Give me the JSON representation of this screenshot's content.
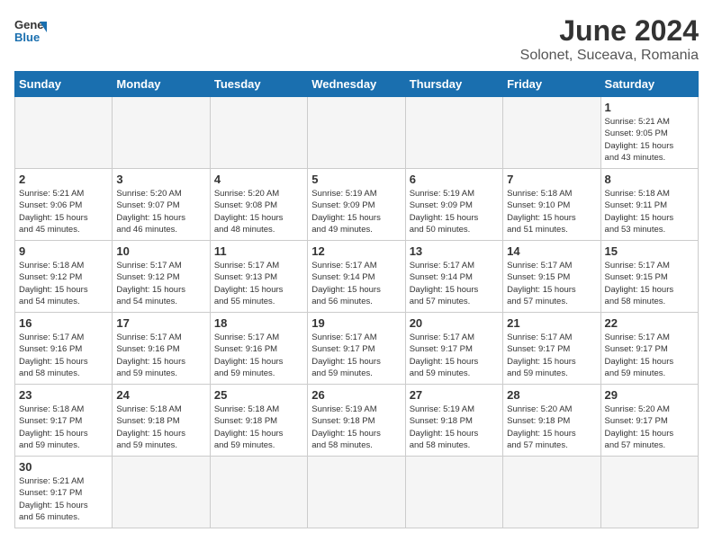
{
  "header": {
    "logo_general": "General",
    "logo_blue": "Blue",
    "title": "June 2024",
    "subtitle": "Solonet, Suceava, Romania"
  },
  "weekdays": [
    "Sunday",
    "Monday",
    "Tuesday",
    "Wednesday",
    "Thursday",
    "Friday",
    "Saturday"
  ],
  "weeks": [
    [
      {
        "day": "",
        "info": ""
      },
      {
        "day": "",
        "info": ""
      },
      {
        "day": "",
        "info": ""
      },
      {
        "day": "",
        "info": ""
      },
      {
        "day": "",
        "info": ""
      },
      {
        "day": "",
        "info": ""
      },
      {
        "day": "1",
        "info": "Sunrise: 5:21 AM\nSunset: 9:05 PM\nDaylight: 15 hours\nand 43 minutes."
      }
    ],
    [
      {
        "day": "2",
        "info": "Sunrise: 5:21 AM\nSunset: 9:06 PM\nDaylight: 15 hours\nand 45 minutes."
      },
      {
        "day": "3",
        "info": "Sunrise: 5:20 AM\nSunset: 9:07 PM\nDaylight: 15 hours\nand 46 minutes."
      },
      {
        "day": "4",
        "info": "Sunrise: 5:20 AM\nSunset: 9:08 PM\nDaylight: 15 hours\nand 48 minutes."
      },
      {
        "day": "5",
        "info": "Sunrise: 5:19 AM\nSunset: 9:09 PM\nDaylight: 15 hours\nand 49 minutes."
      },
      {
        "day": "6",
        "info": "Sunrise: 5:19 AM\nSunset: 9:09 PM\nDaylight: 15 hours\nand 50 minutes."
      },
      {
        "day": "7",
        "info": "Sunrise: 5:18 AM\nSunset: 9:10 PM\nDaylight: 15 hours\nand 51 minutes."
      },
      {
        "day": "8",
        "info": "Sunrise: 5:18 AM\nSunset: 9:11 PM\nDaylight: 15 hours\nand 53 minutes."
      }
    ],
    [
      {
        "day": "9",
        "info": "Sunrise: 5:18 AM\nSunset: 9:12 PM\nDaylight: 15 hours\nand 54 minutes."
      },
      {
        "day": "10",
        "info": "Sunrise: 5:17 AM\nSunset: 9:12 PM\nDaylight: 15 hours\nand 54 minutes."
      },
      {
        "day": "11",
        "info": "Sunrise: 5:17 AM\nSunset: 9:13 PM\nDaylight: 15 hours\nand 55 minutes."
      },
      {
        "day": "12",
        "info": "Sunrise: 5:17 AM\nSunset: 9:14 PM\nDaylight: 15 hours\nand 56 minutes."
      },
      {
        "day": "13",
        "info": "Sunrise: 5:17 AM\nSunset: 9:14 PM\nDaylight: 15 hours\nand 57 minutes."
      },
      {
        "day": "14",
        "info": "Sunrise: 5:17 AM\nSunset: 9:15 PM\nDaylight: 15 hours\nand 57 minutes."
      },
      {
        "day": "15",
        "info": "Sunrise: 5:17 AM\nSunset: 9:15 PM\nDaylight: 15 hours\nand 58 minutes."
      }
    ],
    [
      {
        "day": "16",
        "info": "Sunrise: 5:17 AM\nSunset: 9:16 PM\nDaylight: 15 hours\nand 58 minutes."
      },
      {
        "day": "17",
        "info": "Sunrise: 5:17 AM\nSunset: 9:16 PM\nDaylight: 15 hours\nand 59 minutes."
      },
      {
        "day": "18",
        "info": "Sunrise: 5:17 AM\nSunset: 9:16 PM\nDaylight: 15 hours\nand 59 minutes."
      },
      {
        "day": "19",
        "info": "Sunrise: 5:17 AM\nSunset: 9:17 PM\nDaylight: 15 hours\nand 59 minutes."
      },
      {
        "day": "20",
        "info": "Sunrise: 5:17 AM\nSunset: 9:17 PM\nDaylight: 15 hours\nand 59 minutes."
      },
      {
        "day": "21",
        "info": "Sunrise: 5:17 AM\nSunset: 9:17 PM\nDaylight: 15 hours\nand 59 minutes."
      },
      {
        "day": "22",
        "info": "Sunrise: 5:17 AM\nSunset: 9:17 PM\nDaylight: 15 hours\nand 59 minutes."
      }
    ],
    [
      {
        "day": "23",
        "info": "Sunrise: 5:18 AM\nSunset: 9:17 PM\nDaylight: 15 hours\nand 59 minutes."
      },
      {
        "day": "24",
        "info": "Sunrise: 5:18 AM\nSunset: 9:18 PM\nDaylight: 15 hours\nand 59 minutes."
      },
      {
        "day": "25",
        "info": "Sunrise: 5:18 AM\nSunset: 9:18 PM\nDaylight: 15 hours\nand 59 minutes."
      },
      {
        "day": "26",
        "info": "Sunrise: 5:19 AM\nSunset: 9:18 PM\nDaylight: 15 hours\nand 58 minutes."
      },
      {
        "day": "27",
        "info": "Sunrise: 5:19 AM\nSunset: 9:18 PM\nDaylight: 15 hours\nand 58 minutes."
      },
      {
        "day": "28",
        "info": "Sunrise: 5:20 AM\nSunset: 9:18 PM\nDaylight: 15 hours\nand 57 minutes."
      },
      {
        "day": "29",
        "info": "Sunrise: 5:20 AM\nSunset: 9:17 PM\nDaylight: 15 hours\nand 57 minutes."
      }
    ],
    [
      {
        "day": "30",
        "info": "Sunrise: 5:21 AM\nSunset: 9:17 PM\nDaylight: 15 hours\nand 56 minutes."
      },
      {
        "day": "",
        "info": ""
      },
      {
        "day": "",
        "info": ""
      },
      {
        "day": "",
        "info": ""
      },
      {
        "day": "",
        "info": ""
      },
      {
        "day": "",
        "info": ""
      },
      {
        "day": "",
        "info": ""
      }
    ]
  ]
}
